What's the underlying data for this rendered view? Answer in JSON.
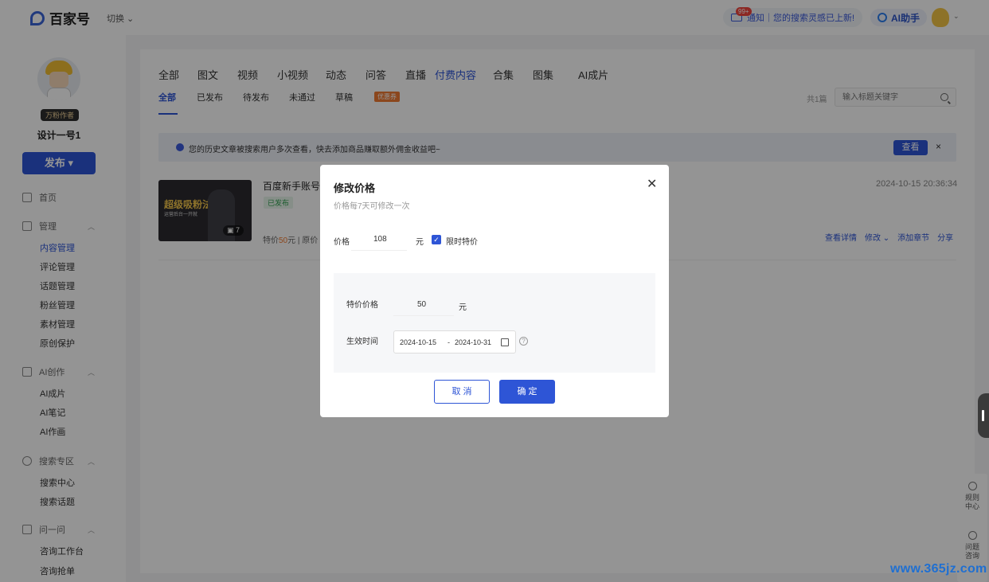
{
  "brand": {
    "name": "百家号",
    "switch_label": "切换"
  },
  "header": {
    "notice_badge": "99+",
    "notice_text": "通知｜您的搜索灵感已上新!",
    "ai_helper_label": "AI助手"
  },
  "sidebar": {
    "rank_badge": "万粉作者",
    "username": "设计一号1",
    "publish_label": "发布",
    "home": "首页",
    "groups": [
      {
        "label": "管理",
        "items": [
          "内容管理",
          "评论管理",
          "话题管理",
          "粉丝管理",
          "素材管理",
          "原创保护"
        ]
      },
      {
        "label": "AI创作",
        "items": [
          "AI成片",
          "AI笔记",
          "AI作画"
        ]
      },
      {
        "label": "搜索专区",
        "items": [
          "搜索中心",
          "搜索话题"
        ]
      },
      {
        "label": "问一问",
        "items": [
          "咨询工作台",
          "咨询抢单"
        ]
      }
    ]
  },
  "tabs_primary": [
    "全部",
    "图文",
    "视频",
    "小视频",
    "动态",
    "问答",
    "直播",
    "付费内容",
    "合集",
    "图集",
    "AI成片"
  ],
  "tabs_secondary": [
    "全部",
    "已发布",
    "待发布",
    "未通过",
    "草稿"
  ],
  "coupon_badge": "优惠券",
  "total_count": "共1篇",
  "search": {
    "placeholder": "输入标题关键字"
  },
  "tip": {
    "text": "您的历史文章被搜索用户多次查看，快去添加商品赚取额外佣金收益吧~",
    "button": "查看",
    "close": "×"
  },
  "item": {
    "thumb_title": "超级吸粉法",
    "thumb_sub": "运营后台一开就",
    "thumb_count": "7",
    "title": "百度新手账号",
    "status": "已发布",
    "price_prefix": "特价",
    "price_value": "50",
    "price_suffix": "元 | 原价",
    "date": "2024-10-15 20:36:34",
    "actions": [
      "查看详情",
      "修改",
      "添加章节",
      "分享"
    ]
  },
  "modal": {
    "title": "修改价格",
    "subtitle": "价格每7天可修改一次",
    "price_label": "价格",
    "price_value": "108",
    "unit": "元",
    "limited_label": "限时特价",
    "special_label": "特价价格",
    "special_value": "50",
    "effective_label": "生效时间",
    "date_start": "2024-10-15",
    "date_sep": "-",
    "date_end": "2024-10-31",
    "cancel": "取 消",
    "confirm": "确 定"
  },
  "float": {
    "rules": "规则中心",
    "help": "问题咨询"
  },
  "watermark": "www.365jz.com",
  "colors": {
    "accent": "#2e55d6",
    "price": "#f07a32",
    "status_green": "#2e9e4f"
  }
}
